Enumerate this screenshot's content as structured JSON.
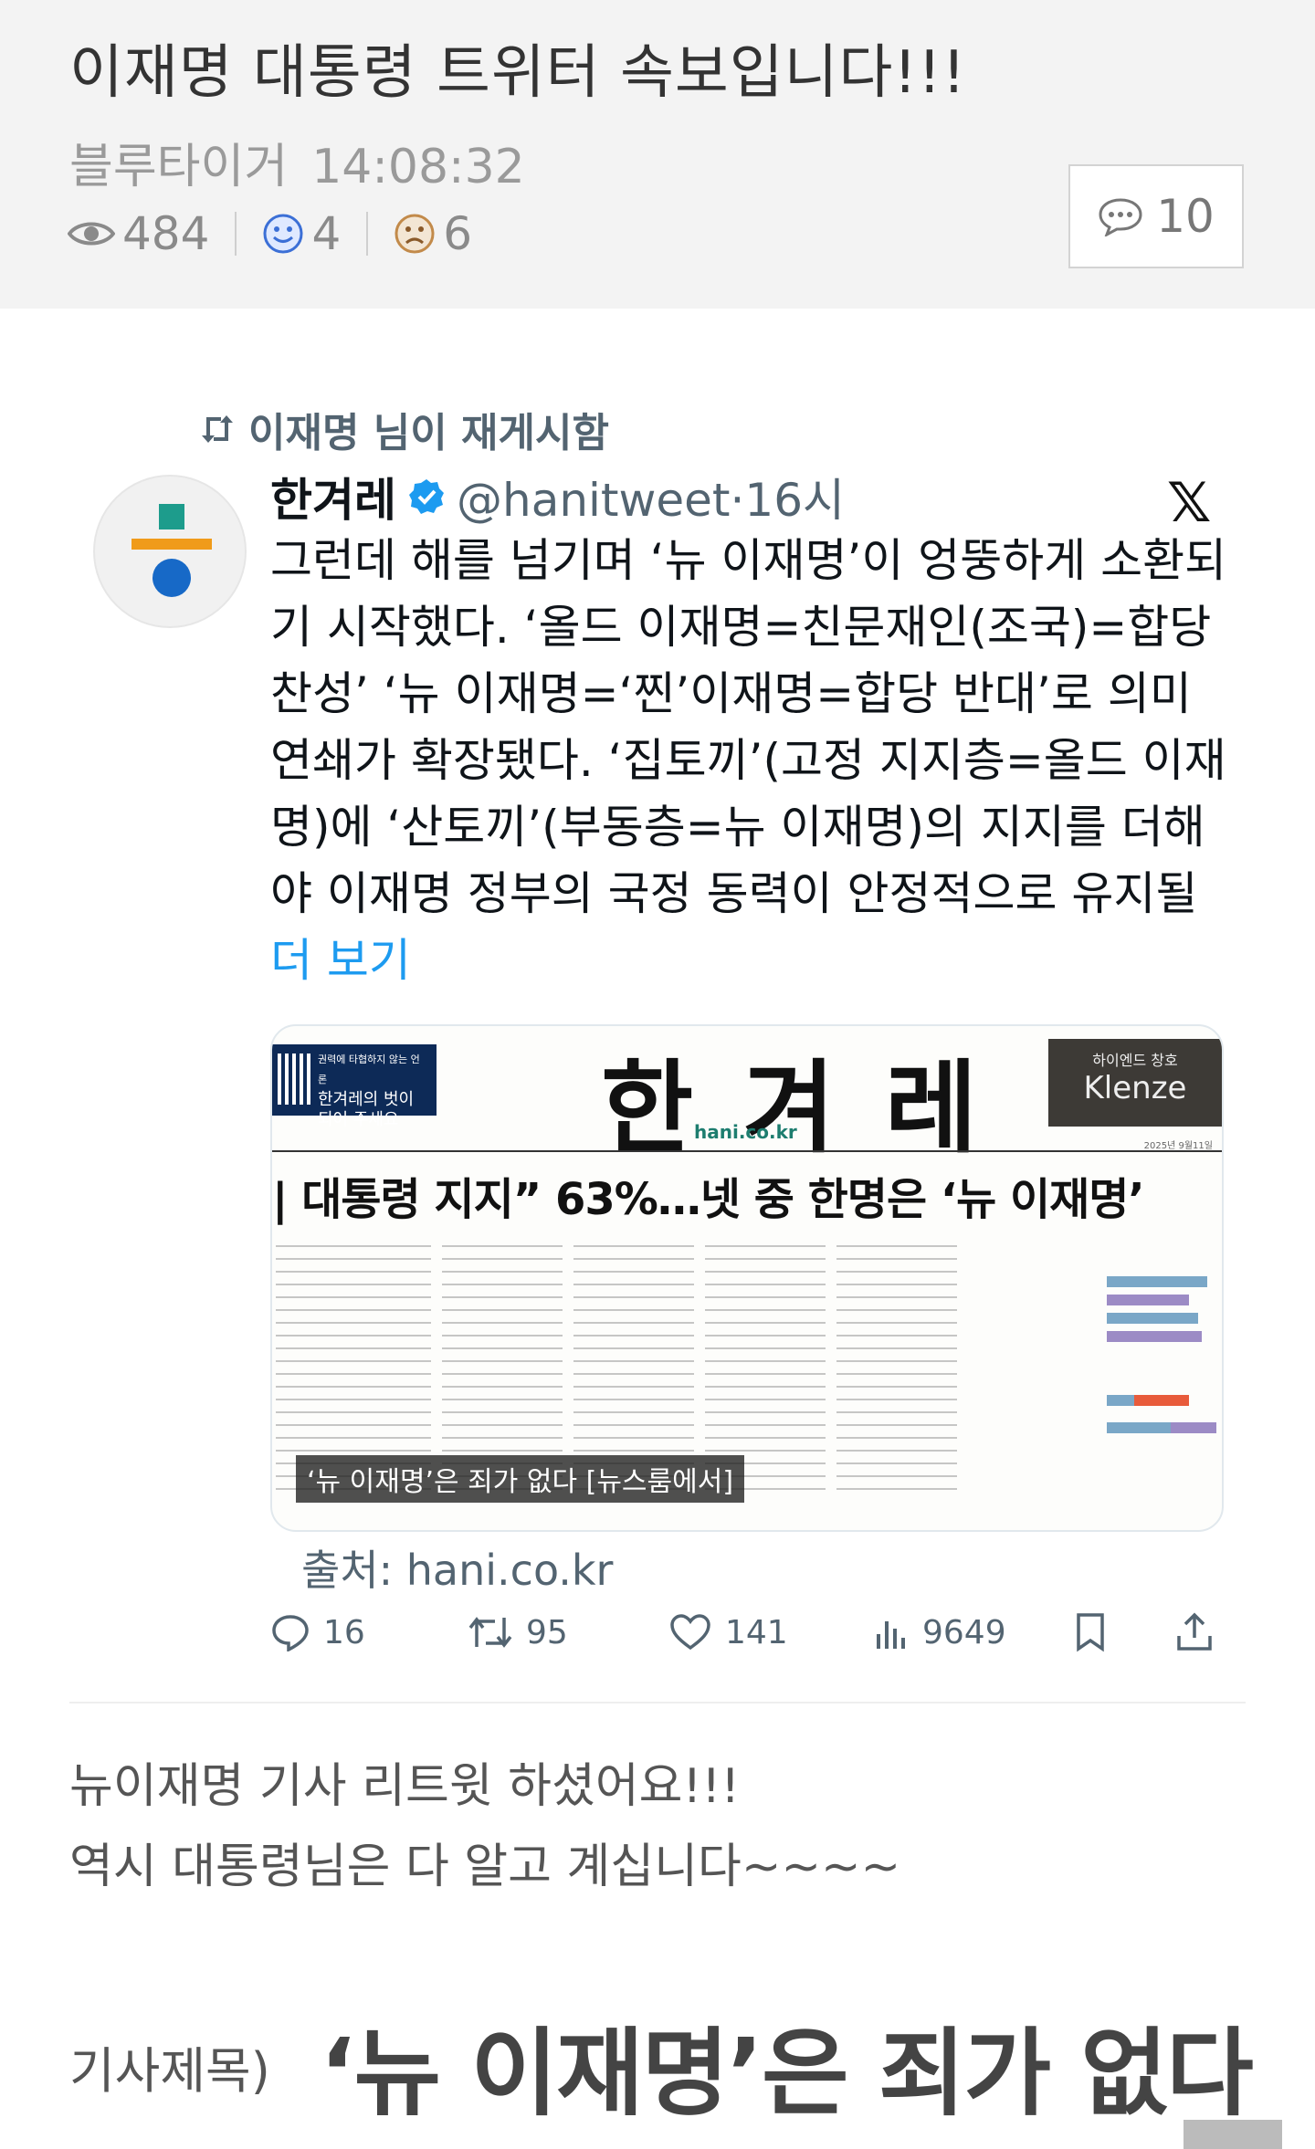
{
  "post": {
    "title": "이재명 대통령 트위터 속보입니다!!!",
    "author": "블루타이거",
    "time": "14:08:32",
    "views": "484",
    "likes": "4",
    "dislikes": "6",
    "comment_count": "10"
  },
  "tweet": {
    "retweeted_by": "이재명 님이 재게시함",
    "display_name": "한겨레",
    "handle_time": "@hanitweet·16시",
    "text": "그런데 해를 넘기며 ‘뉴 이재명’이 엉뚱하게 소환되기 시작했다. ‘올드 이재명=친문재인(조국)=합당 찬성’ ‘뉴 이재명=‘찐’이재명=합당 반대’로 의미 연쇄가 확장됐다. ‘집토끼’(고정 지지층=올드 이재명)에 ‘산토끼’(부동층=뉴 이재명)의 지지를 더해야 이재명 정부의 국정 동력이 안정적으로 유지될 ",
    "more_label": "더 보기",
    "card": {
      "ad_text": "한겨레의 벗이 되어 주세요",
      "ad_small": "권력에 타협하지 않는 언론",
      "masthead": "한 겨 레",
      "site_url": "hani.co.kr",
      "ad2_small": "하이엔드 창호",
      "ad2_brand": "Klenze",
      "headline": "| 대통령 지지” 63%…넷 중 한명은 ‘뉴 이재명’",
      "caption": "‘뉴 이재명’은 죄가 없다 [뉴스룸에서]",
      "date_line": "2025년 9월11일"
    },
    "source": "출처: hani.co.kr",
    "replies": "16",
    "retweets": "95",
    "favorites": "141",
    "views": "9649"
  },
  "body": {
    "line1": "뉴이재명 기사 리트윗 하셨어요!!!",
    "line2": "역시 대통령님은 다 알고 계십니다~~~~",
    "article_label": "기사제목)",
    "article_title": "‘뉴 이재명’은 죄가 없다"
  },
  "colors": {
    "link": "#1d9bf0",
    "verified": "#1d9bf0",
    "header_bg": "#f3f3f3"
  }
}
